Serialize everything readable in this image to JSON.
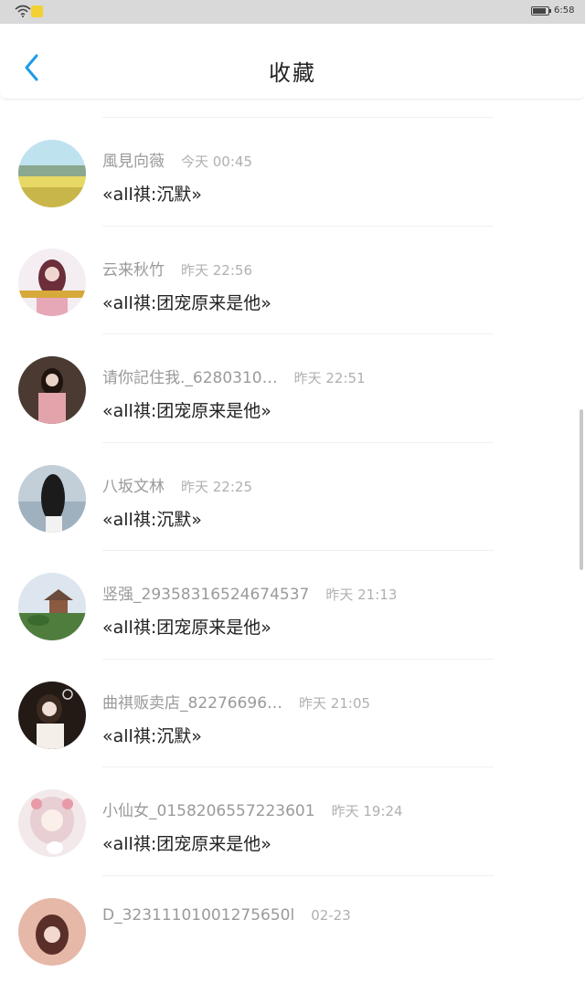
{
  "status_bar": {
    "time": "6:58",
    "icons": [
      "wifi-icon",
      "notification-icon",
      "battery-icon"
    ],
    "battery_level": 0.85
  },
  "header": {
    "title": "收藏",
    "back_icon": "chevron-left-icon",
    "accent_color": "#1e9be6"
  },
  "items": [
    {
      "name": "風見向薇",
      "time": "今天 00:45",
      "content": "«all祺:沉默»"
    },
    {
      "name": "云来秋竹",
      "time": "昨天 22:56",
      "content": "«all祺:团宠原来是他»"
    },
    {
      "name": "请你記住我._6280310…",
      "time": "昨天 22:51",
      "content": "«all祺:团宠原来是他»"
    },
    {
      "name": "八坂文林",
      "time": "昨天 22:25",
      "content": "«all祺:沉默»"
    },
    {
      "name": "竖强_29358316524674537",
      "time": "昨天 21:13",
      "content": "«all祺:团宠原来是他»"
    },
    {
      "name": "曲祺贩卖店_82276696…",
      "time": "昨天 21:05",
      "content": "«all祺:沉默»"
    },
    {
      "name": "小仙女_0158206557223601",
      "time": "昨天 19:24",
      "content": "«all祺:团宠原来是他»"
    },
    {
      "name": "D_32311101001275650l",
      "time": "02-23",
      "content": ""
    }
  ]
}
